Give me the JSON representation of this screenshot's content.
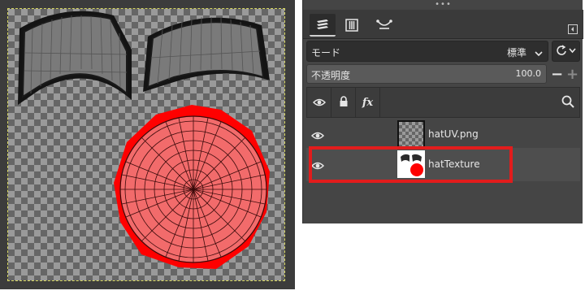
{
  "canvas": {
    "uv_shell_fill": "#7a7a7a",
    "uv_shell_outline": "#1a1a1a",
    "painted_disc_color": "#f26b6b",
    "paint_color": "#ff0000"
  },
  "panel": {
    "grip": "•••",
    "tabs": [
      {
        "name": "layers",
        "icon": "layers-icon",
        "active": true
      },
      {
        "name": "channels",
        "icon": "channels-icon",
        "active": false
      },
      {
        "name": "paths",
        "icon": "paths-icon",
        "active": false
      }
    ],
    "mode": {
      "label": "モード",
      "value": "標準"
    },
    "opacity": {
      "label": "不透明度",
      "value": "100.0",
      "minus": "−",
      "plus": "+"
    },
    "fx_label": "fx",
    "layers": [
      {
        "name": "hatUV.png",
        "visible": true
      },
      {
        "name": "hatTexture",
        "visible": true
      }
    ]
  },
  "colors": {
    "highlight": "#e21c1c",
    "panel_bg": "#454545",
    "canvas_bg": "#3c3c3c"
  }
}
